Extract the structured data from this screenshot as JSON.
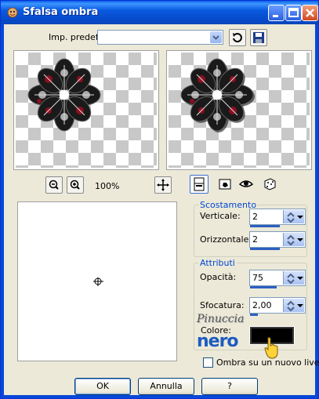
{
  "window": {
    "title": "Sfalsa ombra"
  },
  "preset": {
    "label": "Imp. predef.:",
    "value": ""
  },
  "zoom": {
    "level": "100%"
  },
  "offset_group": {
    "title": "Scostamento",
    "vertical_label": "Verticale:",
    "vertical_value": "2",
    "horizontal_label": "Orizzontale:",
    "horizontal_value": "2"
  },
  "attributes_group": {
    "title": "Attributi",
    "opacity_label": "Opacità:",
    "opacity_value": "75",
    "blur_label": "Sfocatura:",
    "blur_value": "2,00",
    "color_label": "Colore:",
    "color_value": "#000000"
  },
  "watermark": {
    "line1": "Pinuccia",
    "line2": "nero"
  },
  "new_layer": {
    "label": "Ombra su un nuovo livello",
    "checked": false
  },
  "buttons": {
    "ok": "OK",
    "cancel": "Annulla",
    "help": "?"
  }
}
